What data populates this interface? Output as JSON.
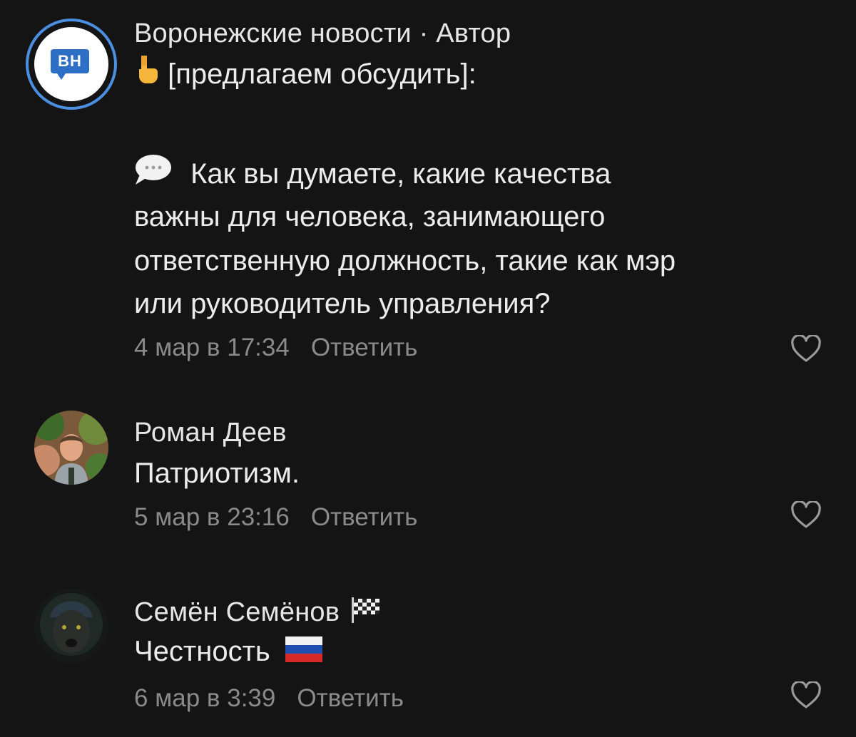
{
  "colors": {
    "background": "#141414",
    "text": "#ececec",
    "muted": "#8a8a8a",
    "accent_ring": "#4a8fe0",
    "badge": "#2e6fc6"
  },
  "comments": [
    {
      "author": "Воронежские новости · Автор",
      "avatar_text": "ВН",
      "lines": [
        "[предлагаем обсудить]:",
        "",
        "Как вы думаете, какие качества",
        "важны для человека, занимающего",
        "ответственную должность, такие как мэр",
        "или руководитель управления?"
      ],
      "line1_emoji": "pointing-down-hand-icon",
      "line3_emoji": "speech-bubble-icon",
      "date": "4 мар в 17:34",
      "reply_label": "Ответить"
    },
    {
      "author": "Роман Деев",
      "avatar_text": "",
      "text": "Патриотизм.",
      "date": "5 мар в 23:16",
      "reply_label": "Ответить"
    },
    {
      "author": "Семён Семёнов",
      "author_emoji": "checkered-flag-icon",
      "text": "Честность",
      "text_emoji": "russia-flag-icon",
      "date": "6 мар в 3:39",
      "reply_label": "Ответить"
    }
  ]
}
